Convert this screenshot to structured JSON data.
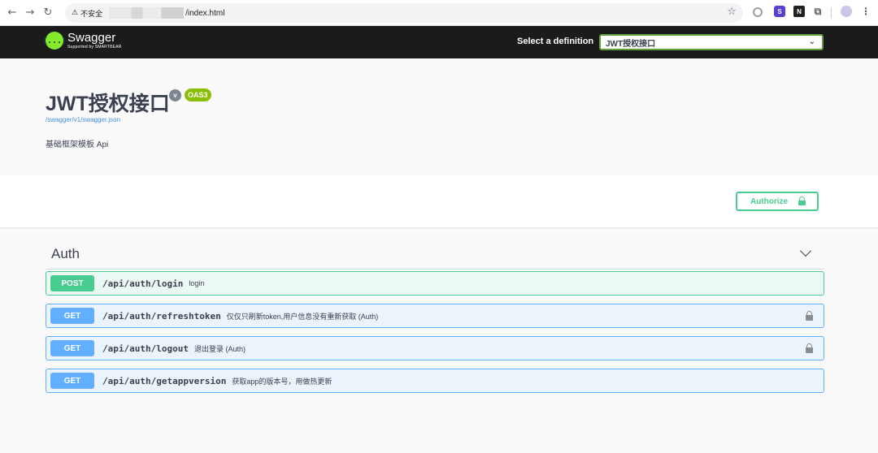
{
  "browser": {
    "back_icon": "←",
    "forward_icon": "→",
    "reload_icon": "↻",
    "warning_icon": "⚠",
    "insecure_label": "不安全",
    "url": "/index.html",
    "star_icon": "☆",
    "ext_2_label": "S",
    "ext_3_label": "N",
    "ext_4_icon": "⧉",
    "menu_icon": "⋮"
  },
  "topbar": {
    "logo_glyph": "{...}",
    "logo_name": "Swagger",
    "logo_sub": "Supported by SMARTBEAR",
    "definition_label": "Select a definition",
    "definition_value": "JWT授权接口",
    "chevron": "⌄"
  },
  "info": {
    "title": "JWT授权接口",
    "version_badge": "v",
    "oas_badge": "OAS3",
    "spec_link": "/swagger/v1/swagger.json",
    "description": "基础框架模板 Api"
  },
  "auth": {
    "authorize_label": "Authorize"
  },
  "tag": {
    "name": "Auth"
  },
  "operations": [
    {
      "method": "POST",
      "path": "/api/auth/login",
      "summary": "login",
      "locked": false
    },
    {
      "method": "GET",
      "path": "/api/auth/refreshtoken",
      "summary": "仅仅只刷新token,用户信息没有重新获取 (Auth)",
      "locked": true
    },
    {
      "method": "GET",
      "path": "/api/auth/logout",
      "summary": "退出登录 (Auth)",
      "locked": true
    },
    {
      "method": "GET",
      "path": "/api/auth/getappversion",
      "summary": "获取app的版本号，用做热更新",
      "locked": false
    }
  ],
  "colors": {
    "post": "#49cc90",
    "get": "#61affe",
    "topbar": "#1b1b1b",
    "oas_badge": "#89bf04"
  }
}
